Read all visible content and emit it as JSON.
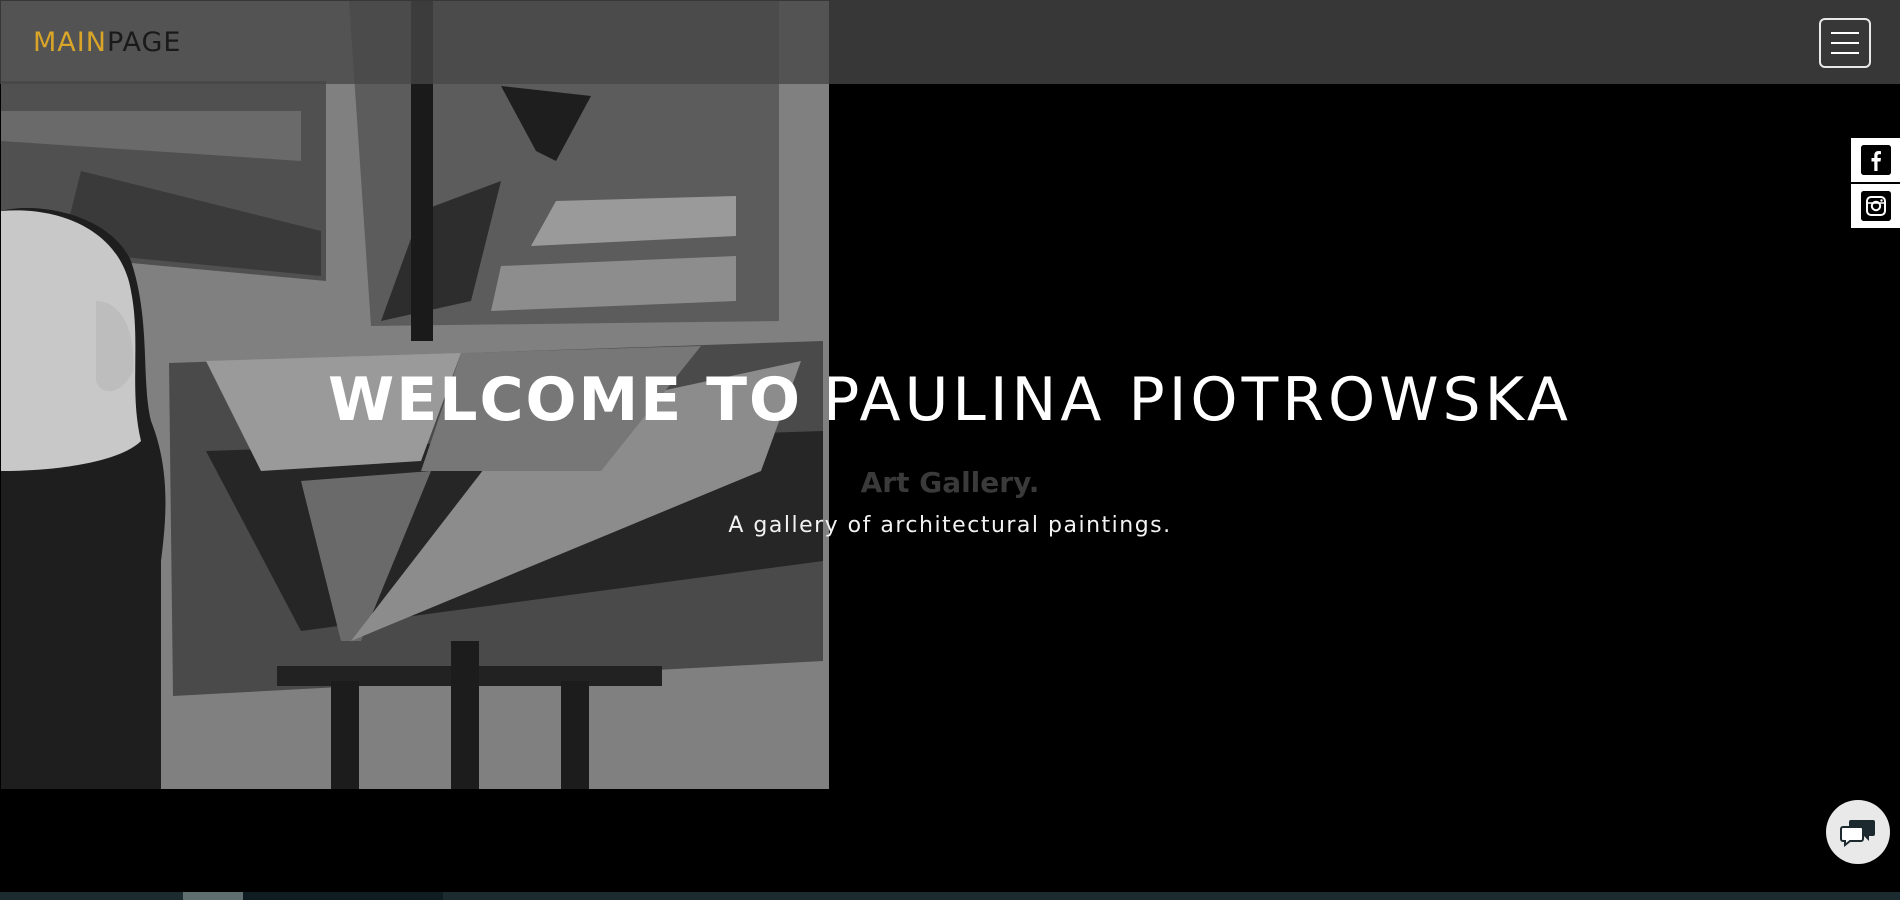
{
  "brand": {
    "part1": "MAIN",
    "part2": "PAGE"
  },
  "hero": {
    "title_bold": "WELCOME TO",
    "title_light": "PAULINA PIOTROWSKA",
    "subtitle": "Art Gallery.",
    "description": "A gallery of architectural paintings."
  },
  "social": [
    {
      "name": "facebook",
      "icon": "facebook-icon",
      "glyph": "f"
    },
    {
      "name": "instagram",
      "icon": "instagram-icon"
    }
  ],
  "icons": {
    "menu": "hamburger-menu-icon",
    "chat": "chat-bubbles-icon"
  },
  "colors": {
    "brand_accent": "#d8a528",
    "brand_dark": "#1a1a1a",
    "navbar": "#464646",
    "background": "#000000"
  }
}
